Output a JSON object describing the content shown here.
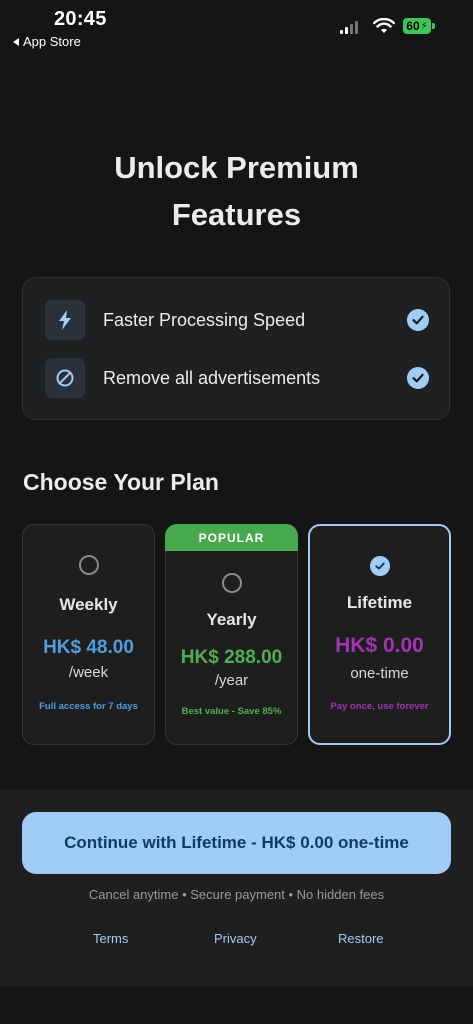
{
  "status_bar": {
    "time": "20:45",
    "back_label": "App Store",
    "battery": "60"
  },
  "title_line1": "Unlock Premium",
  "title_line2": "Features",
  "features": [
    {
      "label": "Faster Processing Speed",
      "icon": "lightning-icon"
    },
    {
      "label": "Remove all advertisements",
      "icon": "no-ads-icon"
    }
  ],
  "plan_heading": "Choose Your Plan",
  "plans": [
    {
      "name": "Weekly",
      "price": "HK$ 48.00",
      "period": "/week",
      "note": "Full access for 7 days",
      "price_color": "#4b9fe0",
      "note_color": "#4b9fe0",
      "selected": false
    },
    {
      "name": "Yearly",
      "price": "HK$ 288.00",
      "period": "/year",
      "note": "Best value - Save 85%",
      "badge": "POPULAR",
      "price_color": "#4cb050",
      "note_color": "#4cb050",
      "selected": false
    },
    {
      "name": "Lifetime",
      "price": "HK$ 0.00",
      "period": "one-time",
      "note": "Pay once, use forever",
      "price_color": "#a133b5",
      "note_color": "#a133b5",
      "selected": true
    }
  ],
  "cta_label": "Continue with Lifetime - HK$ 0.00 one-time",
  "assurance": "Cancel anytime • Secure payment • No hidden fees",
  "links": {
    "terms": "Terms",
    "privacy": "Privacy",
    "restore": "Restore"
  },
  "colors": {
    "accent": "#9fcdf6",
    "background": "#151515",
    "card": "#1f2022",
    "badge": "#48a94e"
  }
}
